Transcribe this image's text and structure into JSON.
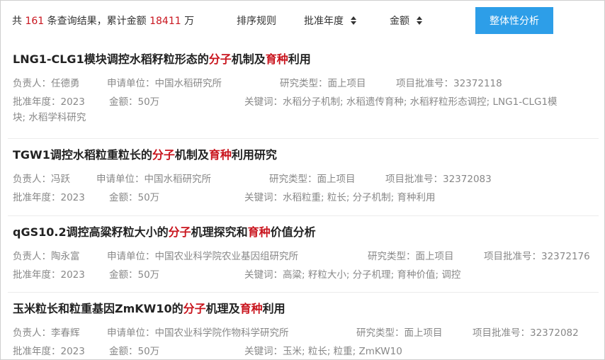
{
  "summary": {
    "prefix": "共",
    "count": "161",
    "middle": "条查询结果，累计金额",
    "total": "18411",
    "suffix": "万"
  },
  "sort": {
    "label": "排序规则",
    "year": "批准年度",
    "amount": "金额"
  },
  "analyze_button": "整体性分析",
  "results": [
    {
      "title_parts": [
        "LNG1-CLG1模块调控水稻籽粒形态的",
        "分子",
        "机制及",
        "育种",
        "利用"
      ],
      "leader": "负责人：任德勇",
      "unit": "申请单位：中国水稻研究所",
      "type": "研究类型：面上项目",
      "approval_no": "项目批准号：32372118",
      "year": "批准年度：2023",
      "amount": "金额：50万",
      "keywords_line1": "关键词：水稻分子机制; 水稻遗传育种; 水稻籽粒形态调控; LNG1-CLG1模",
      "keywords_line2": "块; 水稻学科研究"
    },
    {
      "title_parts": [
        "TGW1调控水稻粒重粒长的",
        "分子",
        "机制及",
        "育种",
        "利用研究"
      ],
      "leader": "负责人：冯跃",
      "unit": "申请单位：中国水稻研究所",
      "type": "研究类型：面上项目",
      "approval_no": "项目批准号：32372083",
      "year": "批准年度：2023",
      "amount": "金额：50万",
      "keywords_line1": "关键词：水稻粒重; 粒长; 分子机制; 育种利用",
      "keywords_line2": ""
    },
    {
      "title_parts": [
        "qGS10.2调控高粱籽粒大小的",
        "分子",
        "机理探究和",
        "育种",
        "价值分析"
      ],
      "leader": "负责人：陶永富",
      "unit": "申请单位：中国农业科学院农业基因组研究所",
      "type": "研究类型：面上项目",
      "approval_no": "项目批准号：32372176",
      "year": "批准年度：2023",
      "amount": "金额：50万",
      "keywords_line1": "关键词：高粱; 籽粒大小; 分子机理; 育种价值; 调控",
      "keywords_line2": ""
    },
    {
      "title_parts": [
        "玉米粒长和粒重基因ZmKW10的",
        "分子",
        "机理及",
        "育种",
        "利用"
      ],
      "leader": "负责人：李春辉",
      "unit": "申请单位：中国农业科学院作物科学研究所",
      "type": "研究类型：面上项目",
      "approval_no": "项目批准号：32372082",
      "year": "批准年度：2023",
      "amount": "金额：50万",
      "keywords_line1": "关键词：玉米; 粒长; 粒重; ZmKW10",
      "keywords_line2": ""
    }
  ],
  "colors": {
    "highlight": "#c9151e",
    "button": "#2d9ee8",
    "meta_text": "#888888"
  }
}
